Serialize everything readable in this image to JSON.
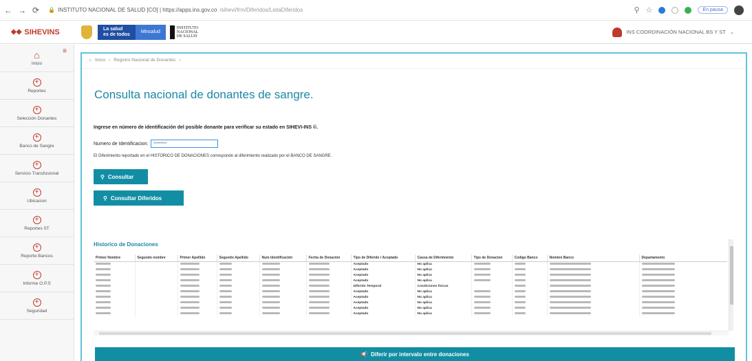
{
  "browser": {
    "url_host": "INSTITUTO NACIONAL DE SALUD [CO] | https://apps.ins.gov.co",
    "url_path": "/sihevi/frm/Diferidos/ListaDiferidos",
    "pause_label": "En pausa"
  },
  "header": {
    "app_name": "SIHEVINS",
    "gov_line1": "La salud",
    "gov_line2": "es de todos",
    "ministry": "Minsalud",
    "ins_logo": "INSTITUTO NACIONAL DE SALUD",
    "user_name": "INS COORDINACIÓN NACIONAL BS Y ST"
  },
  "sidebar": {
    "items": [
      {
        "label": "Inicio"
      },
      {
        "label": "Reportes"
      },
      {
        "label": "Selección Donantes"
      },
      {
        "label": "Banco de Sangre"
      },
      {
        "label": "Servicio Transfusional"
      },
      {
        "label": "Ubicacion"
      },
      {
        "label": "Reportes ST"
      },
      {
        "label": "Reporte Bancos"
      },
      {
        "label": "Informe O.P.S"
      },
      {
        "label": "Seguridad"
      }
    ]
  },
  "breadcrumb": {
    "home": "Inicio",
    "current": "Registro Nacional de Donantes"
  },
  "main": {
    "title": "Consulta nacional de donantes de sangre.",
    "instructions": "Ingrese en número de identificación del posible donante para verificar su estado en SIHEVI-INS ©.",
    "id_label": "Numero de Identificacion:",
    "id_value": "•••••••••",
    "note": "El Diferimiento reportado en el HISTORICO DE DONACIONES corresponde al diferimiento realizado por el BANCO DE SANGRE.",
    "btn_consultar": "Consultar",
    "btn_diferidos": "Consultar Diferidos",
    "history_title": "Historico de Donaciones",
    "btn_intervalo": "Diferir por intervalo entre donaciones"
  },
  "table": {
    "headers": [
      "Primer Nombre",
      "Segundo nombre",
      "Primer Apellido",
      "Segundo Apellido",
      "Num Identificación",
      "Fecha de Donación",
      "Tipo de Diferido / Aceptado",
      "Causa de Diferimiento",
      "Tipo de Donacion",
      "Codigo Banco",
      "Nombre Banco",
      "Departamento"
    ],
    "rows": [
      {
        "tipo": "Aceptado",
        "causa": "No aplica",
        "tipo_donacion": true
      },
      {
        "tipo": "Aceptado",
        "causa": "No aplica",
        "tipo_donacion": true
      },
      {
        "tipo": "Aceptado",
        "causa": "No aplica",
        "tipo_donacion": true
      },
      {
        "tipo": "Aceptado",
        "causa": "No aplica",
        "tipo_donacion": true
      },
      {
        "tipo": "Diferido Temporal",
        "causa": "Condiciones fisicas",
        "tipo_donacion": false
      },
      {
        "tipo": "Aceptado",
        "causa": "No aplica",
        "tipo_donacion": true
      },
      {
        "tipo": "Aceptado",
        "causa": "No aplica",
        "tipo_donacion": true
      },
      {
        "tipo": "Aceptado",
        "causa": "No aplica",
        "tipo_donacion": true
      },
      {
        "tipo": "Aceptado",
        "causa": "No aplica",
        "tipo_donacion": true
      },
      {
        "tipo": "Aceptado",
        "causa": "No aplica",
        "tipo_donacion": true
      }
    ]
  },
  "colors": {
    "accent": "#128ea4",
    "title": "#1b88a4",
    "brand": "#c0392b",
    "panel_border": "#5fc3d9"
  }
}
